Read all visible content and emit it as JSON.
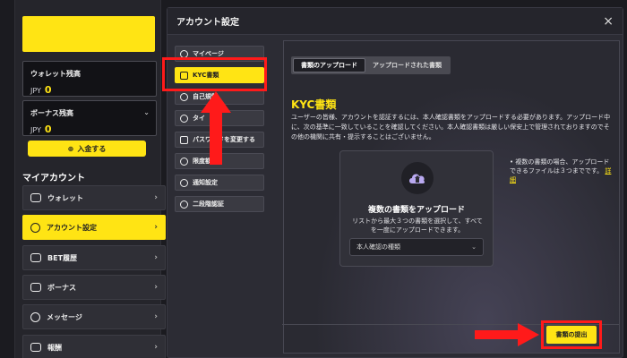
{
  "sidebar": {
    "wallet": {
      "title": "ウォレット残高",
      "currency": "JPY",
      "amount": "0"
    },
    "bonus": {
      "title": "ボーナス残高",
      "currency": "JPY",
      "amount": "0"
    },
    "deposit_label": "入金する",
    "heading": "マイアカウント",
    "items": [
      {
        "label": "ウォレット",
        "icon": "wallet-icon"
      },
      {
        "label": "アカウント設定",
        "icon": "user-icon"
      },
      {
        "label": "BET履歴",
        "icon": "bet-history-icon"
      },
      {
        "label": "ボーナス",
        "icon": "gift-icon"
      },
      {
        "label": "メッセージ",
        "icon": "message-icon"
      },
      {
        "label": "報酬",
        "icon": "crown-icon"
      }
    ]
  },
  "modal": {
    "title": "アカウント設定",
    "close_label": "×",
    "menu": [
      {
        "label": "マイページ",
        "icon": "user-circle-icon"
      },
      {
        "label": "KYC書類",
        "icon": "document-icon"
      },
      {
        "label": "自己規制",
        "icon": "shield-icon"
      },
      {
        "label": "タイ",
        "icon": "clock-icon"
      },
      {
        "label": "パスワードを変更する",
        "icon": "lock-icon"
      },
      {
        "label": "限度額設",
        "icon": "limit-icon"
      },
      {
        "label": "通知設定",
        "icon": "bell-icon"
      },
      {
        "label": "二段階認証",
        "icon": "shield-check-icon"
      }
    ],
    "tabs": [
      "書類のアップロード",
      "アップロードされた書類"
    ],
    "kyc_title": "KYC書類",
    "kyc_description": "ユーザーの皆様、アカウントを認証するには、本人確認書類をアップロードする必要があります。アップロード中に、次の基準に一致していることを確認してください。本人確認書類は厳しい保安上で管理されておりますのでその他の機関に共有・提示することはございません。",
    "upload": {
      "title": "複数の書類をアップロード",
      "description": "リストから最大３つの書類を選択して、すべてを一度にアップロードできます。",
      "select_value": "本人確認の種類"
    },
    "note_text": "• 複数の書類の場合、アップロードできるファイルは３つまでです。",
    "note_link": "詳細",
    "submit_label": "書類の提出"
  },
  "colors": {
    "accent": "#ffe414",
    "annotation": "#ff1a1a"
  }
}
